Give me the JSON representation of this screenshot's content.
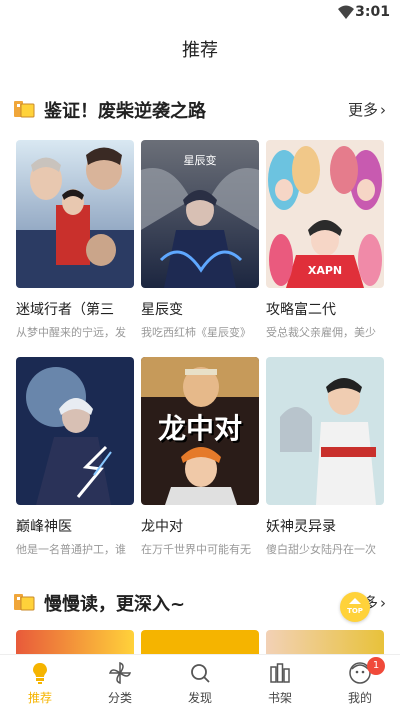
{
  "status_bar": {
    "time": "3:01"
  },
  "header": {
    "title": "推荐"
  },
  "section1": {
    "title": "鉴证！废柴逆袭之路",
    "more": "更多",
    "items": [
      {
        "name": "迷域行者（第三",
        "desc": "从梦中醒来的宁远，发"
      },
      {
        "name": "星辰变",
        "desc": "我吃西红柿《星辰变》",
        "cover_text": "星辰变"
      },
      {
        "name": "攻略富二代",
        "desc": "受总裁父亲雇佣，美少",
        "cover_text": "XAPN"
      },
      {
        "name": "巅峰神医",
        "desc": "他是一名普通护工，谁"
      },
      {
        "name": "龙中对",
        "desc": "在万千世界中可能有无",
        "cover_text": "龙中对"
      },
      {
        "name": "妖神灵异录",
        "desc": "傻白甜少女陆丹在一次"
      }
    ]
  },
  "section2": {
    "title": "慢慢读，更深入~",
    "more": "更多"
  },
  "top_button": {
    "label": "TOP"
  },
  "tabs": [
    {
      "label": "推荐",
      "icon": "bulb-icon",
      "active": true
    },
    {
      "label": "分类",
      "icon": "pinwheel-icon"
    },
    {
      "label": "发现",
      "icon": "search-icon"
    },
    {
      "label": "书架",
      "icon": "shelf-icon"
    },
    {
      "label": "我的",
      "icon": "avatar-icon",
      "badge": "1"
    }
  ],
  "colors": {
    "accent": "#f5b400",
    "badge": "#f04a3a"
  }
}
